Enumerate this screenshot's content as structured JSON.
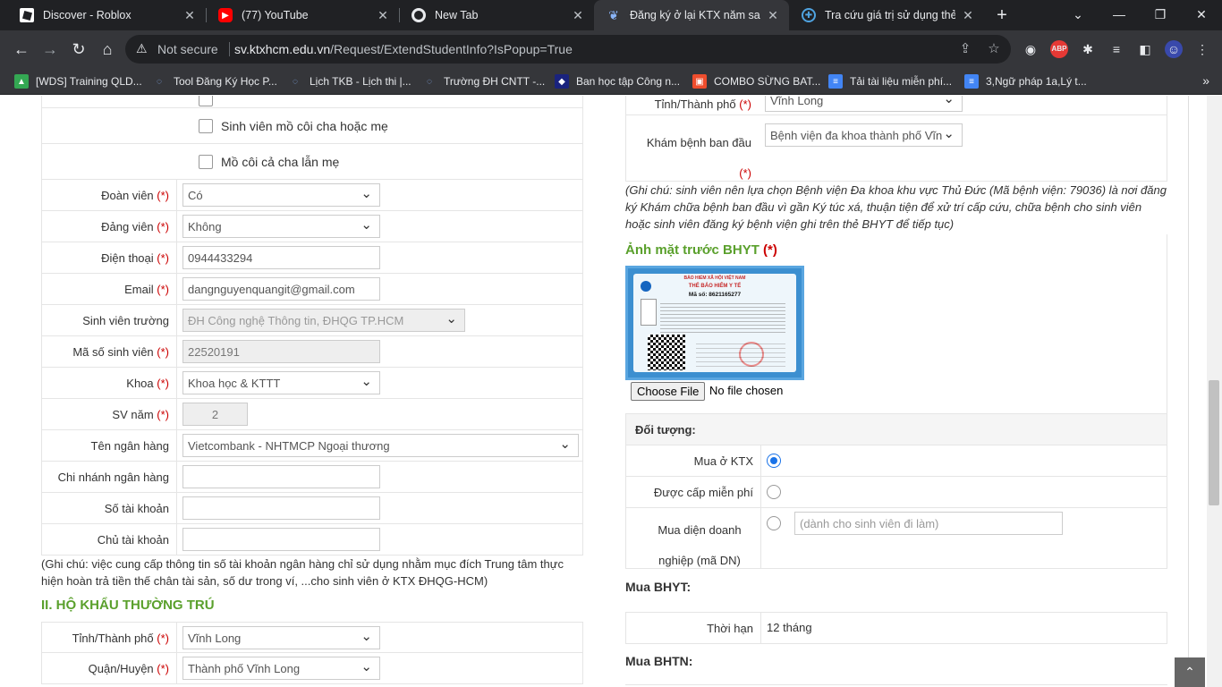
{
  "browser": {
    "tabs": [
      {
        "title": "Discover - Roblox",
        "icon": "roblox-icon",
        "color": "#ffffff"
      },
      {
        "title": "(77) YouTube",
        "icon": "youtube-icon",
        "color": "#ff0000"
      },
      {
        "title": "New Tab",
        "icon": "chrome-icon",
        "color": "#e8eaed"
      },
      {
        "title": "Đăng ký ở lại KTX năm sau -",
        "icon": "ktx-icon",
        "color": "#1a73e8"
      },
      {
        "title": "Tra cứu giá trị sử dụng thẻ BH",
        "icon": "bhyt-icon",
        "color": "#4fa3e0"
      }
    ],
    "not_secure": "Not secure",
    "url_host": "sv.ktxhcm.edu.vn",
    "url_path": "/Request/ExtendStudentInfo?IsPopup=True",
    "bookmarks": [
      {
        "label": "[WDS] Training QLD...",
        "icon": "drive-icon",
        "color": "#34a853"
      },
      {
        "label": "Tool Đăng Ký Học P...",
        "icon": "uit-icon",
        "color": "#3367d6"
      },
      {
        "label": "Lịch TKB - Lịch thi |...",
        "icon": "uit-icon",
        "color": "#3367d6"
      },
      {
        "label": "Trường ĐH CNTT -...",
        "icon": "uit-icon",
        "color": "#3367d6"
      },
      {
        "label": "Ban học tập Công n...",
        "icon": "bht-icon",
        "color": "#1a237e"
      },
      {
        "label": "COMBO SỪNG BAT...",
        "icon": "shop-icon",
        "color": "#ee4d2d"
      },
      {
        "label": "Tải tài liệu miễn phí...",
        "icon": "doc-icon",
        "color": "#4285f4"
      },
      {
        "label": "3,Ngữ pháp 1a,Lý t...",
        "icon": "doc-icon",
        "color": "#4285f4"
      }
    ]
  },
  "left": {
    "checkboxes": [
      {
        "label": "Sinh viên mồ côi cha hoặc mẹ"
      },
      {
        "label": "Mồ côi cả cha lẫn mẹ"
      }
    ],
    "fields": [
      {
        "label": "Đoàn viên",
        "required": true,
        "value": "Có",
        "type": "select"
      },
      {
        "label": "Đảng viên",
        "required": true,
        "value": "Không",
        "type": "select"
      },
      {
        "label": "Điện thoại",
        "required": true,
        "value": "0944433294",
        "type": "text"
      },
      {
        "label": "Email",
        "required": true,
        "value": "dangnguyenquangit@gmail.com",
        "type": "text"
      },
      {
        "label": "Sinh viên trường",
        "required": false,
        "value": "ĐH Công nghệ Thông tin, ĐHQG TP.HCM",
        "type": "select-disabled"
      },
      {
        "label": "Mã số sinh viên",
        "required": true,
        "value": "22520191",
        "type": "disabled"
      },
      {
        "label": "Khoa",
        "required": true,
        "value": "Khoa học & KTTT",
        "type": "select"
      },
      {
        "label": "SV năm",
        "required": true,
        "value": "2",
        "type": "disabled-small"
      },
      {
        "label": "Tên ngân hàng",
        "required": false,
        "value": "Vietcombank - NHTMCP Ngoại thương",
        "type": "select-wide"
      },
      {
        "label": "Chi nhánh ngân hàng",
        "required": false,
        "value": "",
        "type": "text"
      },
      {
        "label": "Số tài khoản",
        "required": false,
        "value": "",
        "type": "text"
      },
      {
        "label": "Chủ tài khoản",
        "required": false,
        "value": "",
        "type": "text"
      }
    ],
    "bank_note": "(Ghi chú: việc cung cấp thông tin số tài khoản ngân hàng chỉ sử dụng nhằm mục đích Trung tâm thực hiện hoàn trả tiền thế chân tài sản, số dư trong ví, ...cho sinh viên ở KTX ĐHQG-HCM)",
    "section2_title": "II. HỘ KHẨU THƯỜNG TRÚ",
    "address": [
      {
        "label": "Tỉnh/Thành phố",
        "required": true,
        "value": "Vĩnh Long"
      },
      {
        "label": "Quận/Huyện",
        "required": true,
        "value": "Thành phố Vĩnh Long"
      }
    ]
  },
  "right": {
    "province_label": "Tỉnh/Thành phố",
    "province_value": "Vĩnh Long",
    "hospital_label": "Khám bệnh ban đầu",
    "hospital_value": "Bệnh viện đa khoa thành phố Vĩn",
    "hospital_note": "(Ghi chú: sinh viên nên lựa chọn Bệnh viện Đa khoa khu vực Thủ Đức (Mã bệnh viện: 79036) là nơi đăng ký Khám chữa bệnh ban đầu vì gần Ký túc xá, thuận tiện để xử trí cấp cứu, chữa bệnh cho sinh viên hoặc sinh viên đăng ký bệnh viện ghi trên thẻ BHYT để tiếp tục)",
    "photo_title": "Ảnh mặt trước BHYT",
    "photo_required": "(*)",
    "card": {
      "header": "BẢO HIỂM XÃ HỘI VIỆT NAM",
      "title": "THẺ BẢO HIỂM Y TẾ",
      "number": "Mã số: 8621165277"
    },
    "choose_file": "Choose File",
    "no_file": "No file chosen",
    "doi_tuong_title": "Đối tượng:",
    "options": [
      {
        "label": "Mua ở KTX",
        "checked": true
      },
      {
        "label": "Được cấp miễn phí",
        "checked": false
      },
      {
        "label": "Mua diện doanh nghiệp (mã DN)",
        "checked": false
      }
    ],
    "dn_placeholder": "(dành cho sinh viên đi làm)",
    "mua_bhyt": "Mua BHYT:",
    "thoi_han_label": "Thời hạn",
    "thoi_han_value": "12 tháng",
    "mua_bhtn": "Mua BHTN:"
  },
  "required_mark": "(*)"
}
